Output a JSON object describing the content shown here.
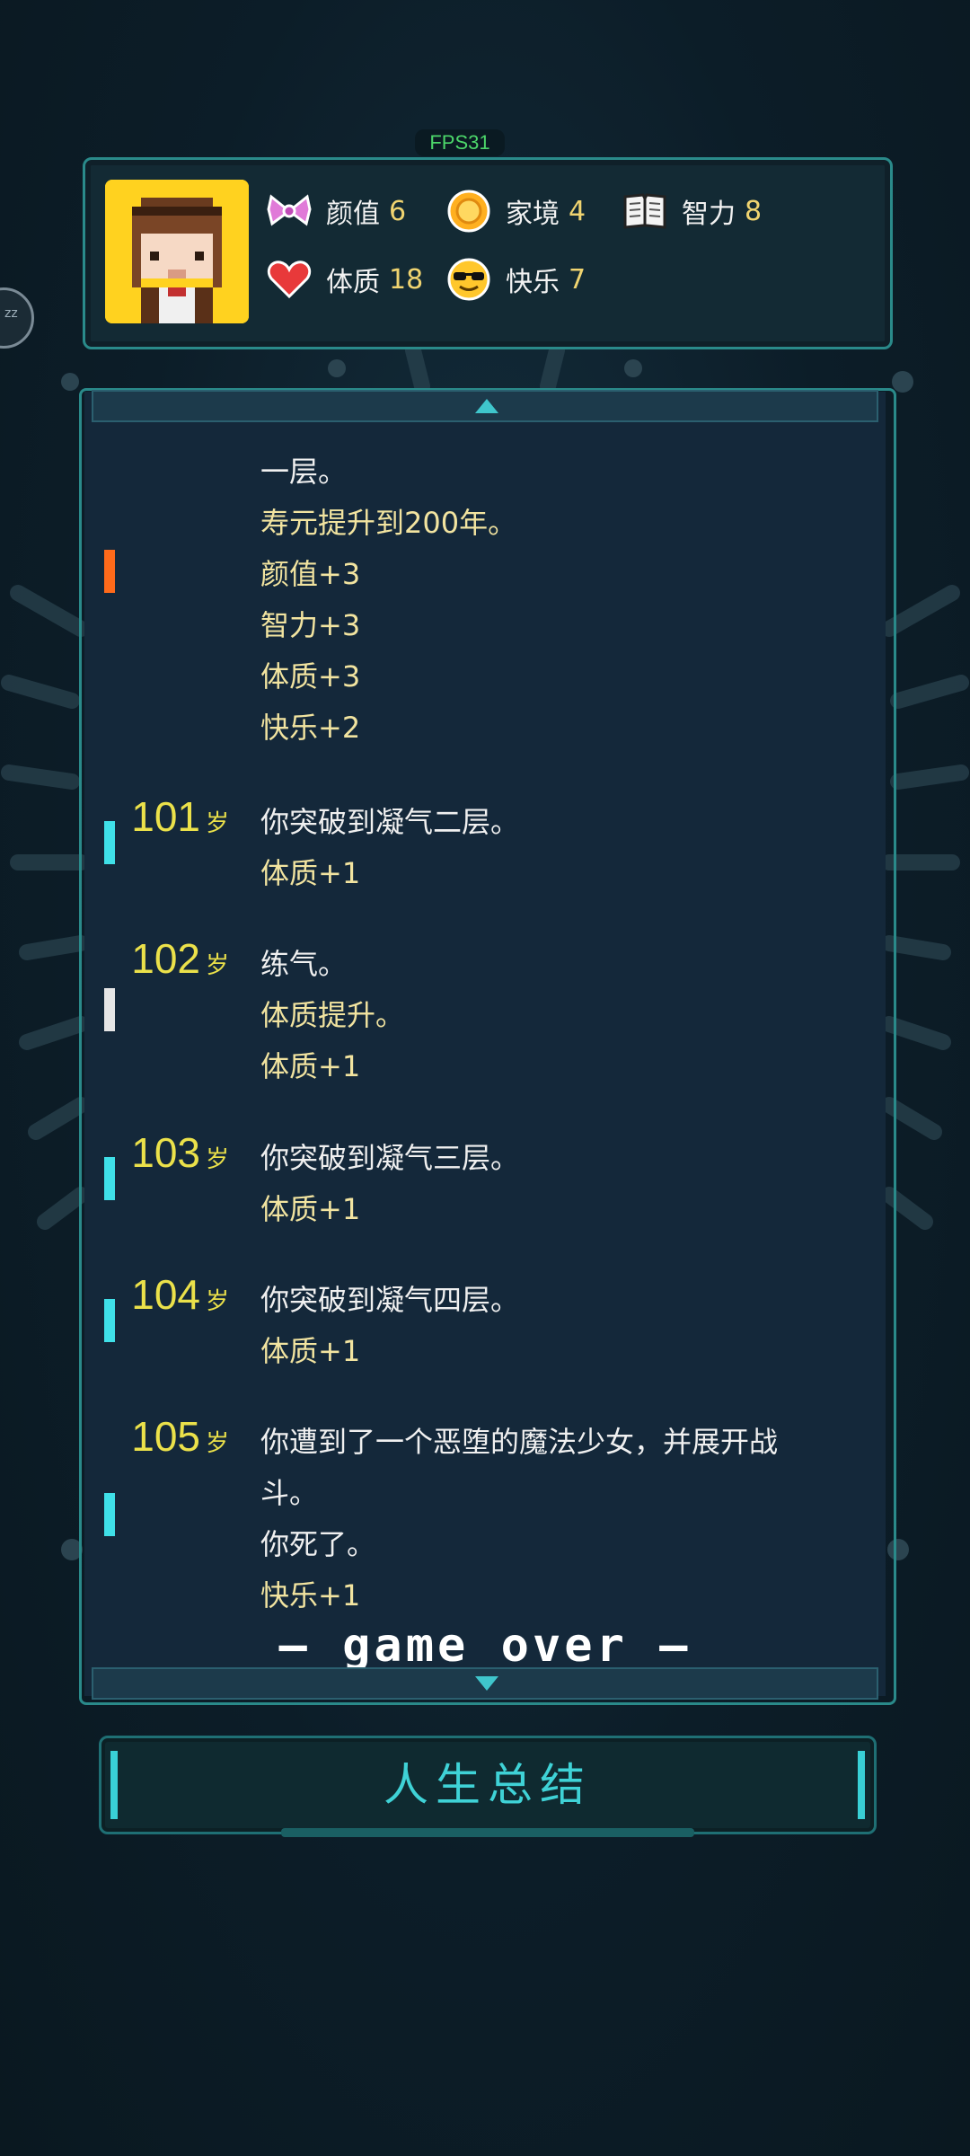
{
  "fps": "FPS31",
  "stats": [
    {
      "icon": "bow-icon",
      "label": "颜值",
      "value": "6"
    },
    {
      "icon": "coin-icon",
      "label": "家境",
      "value": "4"
    },
    {
      "icon": "book-icon",
      "label": "智力",
      "value": "8"
    },
    {
      "icon": "heart-icon",
      "label": "体质",
      "value": "18"
    },
    {
      "icon": "sunglasses-icon",
      "label": "快乐",
      "value": "7"
    }
  ],
  "log": {
    "age_suffix": "岁",
    "partial_entry": {
      "lines": [
        "一层。",
        "寿元提升到200年。",
        "颜值+3",
        "智力+3",
        "体质+3",
        "快乐+2"
      ]
    },
    "entries": [
      {
        "age": "101",
        "lines": [
          "你突破到凝气二层。",
          "体质+1"
        ]
      },
      {
        "age": "102",
        "lines": [
          "练气。",
          "体质提升。",
          "体质+1"
        ]
      },
      {
        "age": "103",
        "lines": [
          "你突破到凝气三层。",
          "体质+1"
        ]
      },
      {
        "age": "104",
        "lines": [
          "你突破到凝气四层。",
          "体质+1"
        ]
      },
      {
        "age": "105",
        "lines": [
          "你遭到了一个恶堕的魔法少女，并展开战",
          "斗。",
          "你死了。",
          "快乐+1"
        ]
      }
    ],
    "game_over": "— game over —"
  },
  "summary_button": "人生总结",
  "colors": {
    "accent": "#2a8a8a",
    "age": "#ebe14a",
    "marker_orange": "#ff6a1a",
    "marker_cyan": "#3fe0e8",
    "marker_white": "#e6e6e6"
  }
}
